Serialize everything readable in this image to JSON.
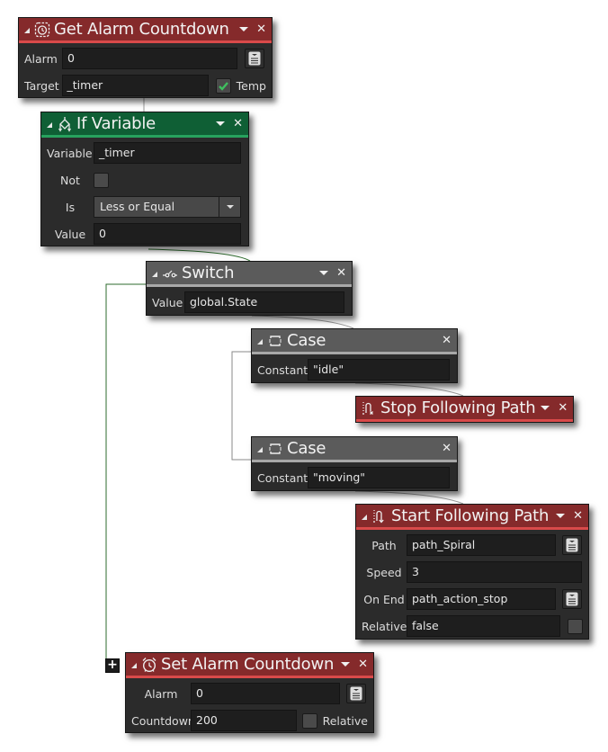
{
  "nodes": {
    "get_alarm": {
      "title": "Get Alarm Countdown",
      "icon": "alarm-clock-dashed-icon",
      "fields": {
        "alarm_label": "Alarm",
        "alarm_value": "0",
        "target_label": "Target",
        "target_value": "_timer",
        "temp_label": "Temp",
        "temp_checked": true
      }
    },
    "if_variable": {
      "title": "If Variable",
      "icon": "branch-icon",
      "fields": {
        "variable_label": "Variable",
        "variable_value": "_timer",
        "not_label": "Not",
        "not_checked": false,
        "is_label": "Is",
        "is_value": "Less or Equal",
        "value_label": "Value",
        "value_value": "0"
      }
    },
    "switch": {
      "title": "Switch",
      "icon": "switch-icon",
      "fields": {
        "value_label": "Value",
        "value_value": "global.State"
      }
    },
    "case_idle": {
      "title": "Case",
      "icon": "case-bracket-icon",
      "fields": {
        "constant_label": "Constant",
        "constant_value": "\"idle\""
      }
    },
    "stop_path": {
      "title": "Stop Following Path",
      "icon": "path-stop-icon"
    },
    "case_moving": {
      "title": "Case",
      "icon": "case-bracket-icon",
      "fields": {
        "constant_label": "Constant",
        "constant_value": "\"moving\""
      }
    },
    "start_path": {
      "title": "Start Following Path",
      "icon": "path-start-icon",
      "fields": {
        "path_label": "Path",
        "path_value": "path_Spiral",
        "speed_label": "Speed",
        "speed_value": "3",
        "onend_label": "On End",
        "onend_value": "path_action_stop",
        "relative_label": "Relative",
        "relative_value": "false",
        "relative_checked": false
      }
    },
    "set_alarm": {
      "title": "Set Alarm Countdown",
      "icon": "alarm-clock-icon",
      "fields": {
        "alarm_label": "Alarm",
        "alarm_value": "0",
        "countdown_label": "Countdown",
        "countdown_value": "200",
        "relative_label": "Relative",
        "relative_checked": false
      }
    }
  },
  "add_button_label": "+",
  "colors": {
    "action_header": "#852a2b",
    "action_accent": "#d94a4a",
    "condition_header": "#0f5f35",
    "condition_accent": "#27a25e",
    "control_header": "#5b5b5b",
    "control_accent": "#a8a8a8",
    "else_connector": "#2e6b2e"
  }
}
